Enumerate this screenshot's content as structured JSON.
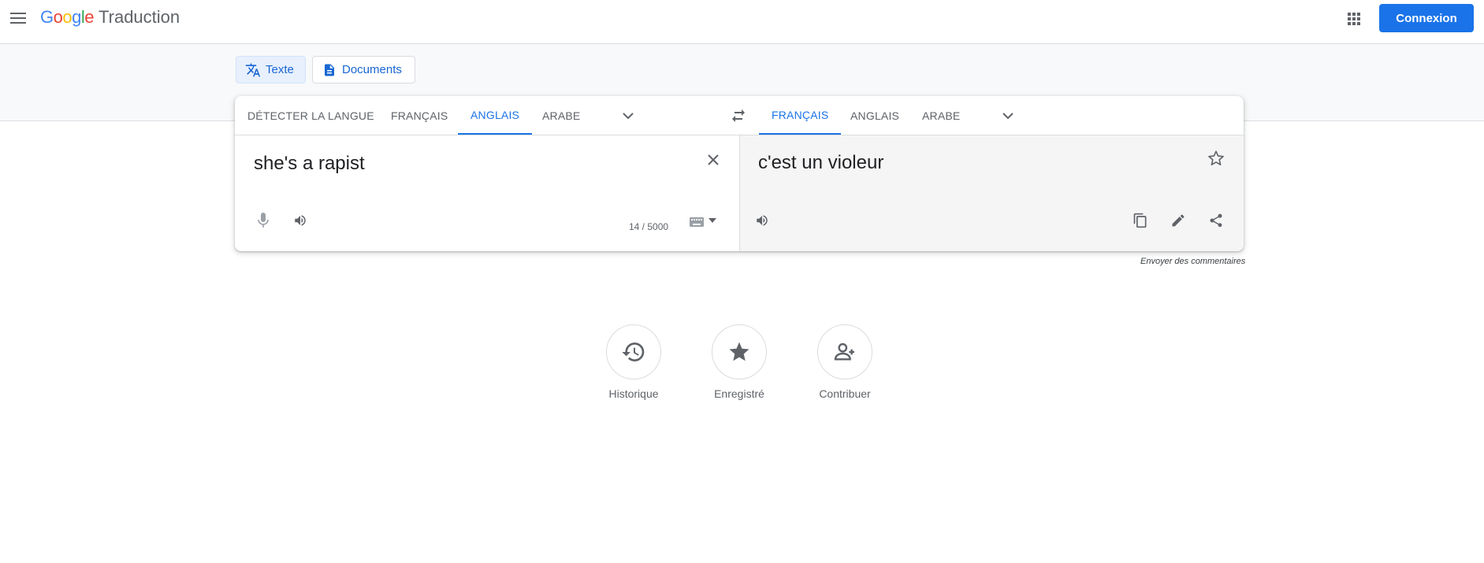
{
  "header": {
    "logo_letters": [
      "G",
      "o",
      "o",
      "g",
      "l",
      "e"
    ],
    "product": "Traduction",
    "signin_label": "Connexion"
  },
  "modes": [
    {
      "label": "Texte",
      "icon": "translate-icon",
      "active": true
    },
    {
      "label": "Documents",
      "icon": "document-icon",
      "active": false
    }
  ],
  "source_langs": [
    {
      "label": "DÉTECTER LA LANGUE",
      "active": false
    },
    {
      "label": "FRANÇAIS",
      "active": false
    },
    {
      "label": "ANGLAIS",
      "active": true
    },
    {
      "label": "ARABE",
      "active": false
    }
  ],
  "target_langs": [
    {
      "label": "FRANÇAIS",
      "active": true
    },
    {
      "label": "ANGLAIS",
      "active": false
    },
    {
      "label": "ARABE",
      "active": false
    }
  ],
  "source": {
    "text": "she's a rapist",
    "char_count": "14 / 5000"
  },
  "target": {
    "text": "c'est un violeur"
  },
  "feedback_label": "Envoyer des commentaires",
  "bottom_actions": [
    {
      "label": "Historique",
      "icon": "history-icon"
    },
    {
      "label": "Enregistré",
      "icon": "star-icon"
    },
    {
      "label": "Contribuer",
      "icon": "contribute-icon"
    }
  ],
  "colors": {
    "accent": "#1a73e8",
    "logo": [
      "#4285f4",
      "#ea4335",
      "#fbbc05",
      "#4285f4",
      "#34a853",
      "#ea4335"
    ]
  }
}
